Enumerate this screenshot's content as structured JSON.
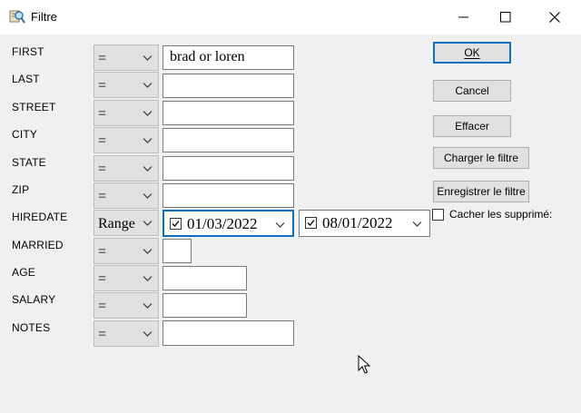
{
  "window": {
    "title": "Filtre",
    "icon": "filter-app-icon"
  },
  "fields": [
    {
      "label": "FIRST",
      "op": "=",
      "value": "brad or loren"
    },
    {
      "label": "LAST",
      "op": "=",
      "value": ""
    },
    {
      "label": "STREET",
      "op": "=",
      "value": ""
    },
    {
      "label": "CITY",
      "op": "=",
      "value": ""
    },
    {
      "label": "STATE",
      "op": "=",
      "value": ""
    },
    {
      "label": "ZIP",
      "op": "=",
      "value": ""
    },
    {
      "label": "HIREDATE",
      "op": "Range",
      "from": "01/03/2022",
      "to": "08/01/2022",
      "from_checked": true,
      "to_checked": true
    },
    {
      "label": "MARRIED",
      "op": "=",
      "value": ""
    },
    {
      "label": "AGE",
      "op": "=",
      "value": ""
    },
    {
      "label": "SALARY",
      "op": "=",
      "value": ""
    },
    {
      "label": "NOTES",
      "op": "=",
      "value": ""
    }
  ],
  "buttons": {
    "ok": "OK",
    "cancel": "Cancel",
    "clear": "Effacer",
    "load_filter": "Charger le filtre",
    "save_filter": "Enregistrer le filtre"
  },
  "show_deleted": {
    "label": "Cacher les supprimé:",
    "checked": false
  },
  "colors": {
    "accent": "#0f6fc6",
    "background": "#f0f0f0",
    "button": "#e1e1e1"
  }
}
